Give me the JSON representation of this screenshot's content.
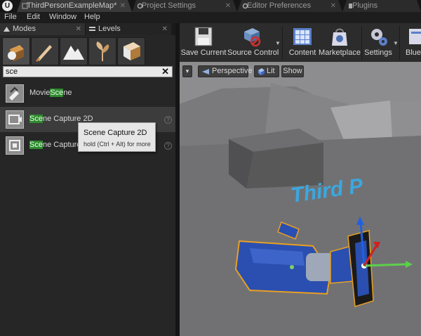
{
  "tabs": [
    {
      "label": "ThirdPersonExampleMap*",
      "active": true
    },
    {
      "label": "Project Settings",
      "active": false
    },
    {
      "label": "Editor Preferences",
      "active": false
    },
    {
      "label": "Plugins",
      "active": false
    }
  ],
  "menu": [
    "File",
    "Edit",
    "Window",
    "Help"
  ],
  "panel_tabs": [
    {
      "label": "Modes",
      "active": true
    },
    {
      "label": "Levels",
      "active": false
    }
  ],
  "modes": [
    "place-mode",
    "paint-mode",
    "landscape-mode",
    "foliage-mode",
    "geometry-edit-mode"
  ],
  "search": {
    "value": "sce",
    "clear_label": "✕"
  },
  "results": [
    {
      "pre": "Movie",
      "match": "Sce",
      "post": "ne",
      "hover": false
    },
    {
      "pre": "",
      "match": "Sce",
      "post": "ne Capture 2D",
      "hover": true
    },
    {
      "pre": "",
      "match": "Sce",
      "post": "ne Capture Cube",
      "hover": false
    }
  ],
  "tooltip": {
    "title": "Scene Capture 2D",
    "hint": "hold (Ctrl + Alt) for more"
  },
  "toolbar": [
    {
      "label": "Save Current"
    },
    {
      "label": "Source Control"
    },
    {
      "label": "Content"
    },
    {
      "label": "Marketplace"
    },
    {
      "label": "Settings"
    },
    {
      "label": "Blueprints"
    }
  ],
  "viewport": {
    "menu_label": "▾",
    "perspective_label": "Perspective",
    "lit_label": "Lit",
    "show_label": "Show",
    "floor_text": "Third P"
  },
  "colors": {
    "search_highlight": "#2f8a2f",
    "camera_body": "#2b4fb0",
    "selection_outline": "#e8a020"
  }
}
